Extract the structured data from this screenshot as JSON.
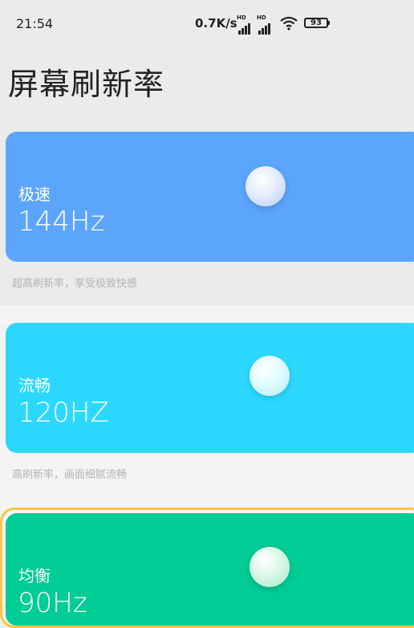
{
  "status_bar": {
    "time": "21:54",
    "net_speed": "0.7K/s",
    "signal_1_badge": "HD",
    "signal_2_badge": "HD",
    "battery": "93"
  },
  "page": {
    "title": "屏幕刷新率"
  },
  "options": [
    {
      "name": "极速",
      "rate": "144Hz",
      "description": "超高刷新率，享受极致快感",
      "color": "#5ca5fc"
    },
    {
      "name": "流畅",
      "rate": "120HZ",
      "description": "高刷新率，画面细腻流畅",
      "color": "#2cd8ff"
    },
    {
      "name": "均衡",
      "rate": "90Hz",
      "color": "#00cc95",
      "selected": true
    }
  ],
  "colors": {
    "selected_ring": "#f5c845",
    "description_text": "#b3b3b3"
  }
}
